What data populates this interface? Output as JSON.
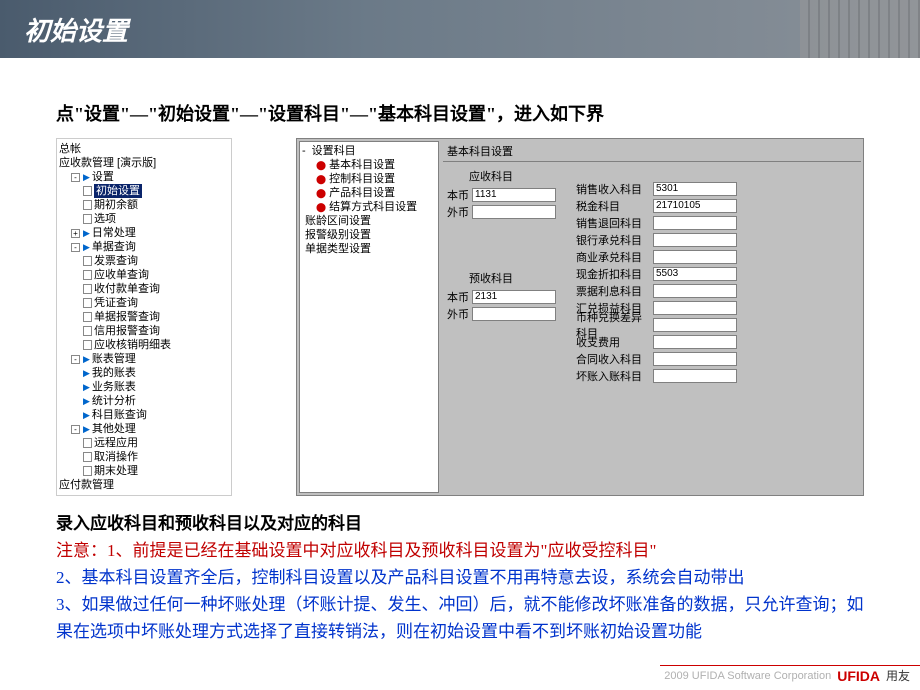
{
  "header": {
    "title": "初始设置"
  },
  "subtitle": "点\"设置\"—\"初始设置\"—\"设置科目\"—\"基本科目设置\"，进入如下界",
  "tree_left": {
    "root1": "总帐",
    "root2": "应收款管理 [演示版]",
    "n_settings": "设置",
    "n_init": "初始设置",
    "n_balance": "期初余额",
    "n_option": "选项",
    "n_daily": "日常处理",
    "n_bill": "单据查询",
    "n_invoice": "发票查询",
    "n_receipt": "应收单查询",
    "n_payment": "收付款单查询",
    "n_voucher": "凭证查询",
    "n_alarm": "单据报警查询",
    "n_credit": "信用报警查询",
    "n_verify": "应收核销明细表",
    "n_account": "账表管理",
    "n_myacc": "我的账表",
    "n_bizacc": "业务账表",
    "n_stat": "统计分析",
    "n_subacc": "科目账查询",
    "n_other": "其他处理",
    "n_remote": "远程应用",
    "n_cancel": "取消操作",
    "n_period": "期末处理",
    "root3": "应付款管理"
  },
  "tree_mid": {
    "root": "设置科目",
    "n1": "基本科目设置",
    "n2": "控制科目设置",
    "n3": "产品科目设置",
    "n4": "结算方式科目设置",
    "n5": "账龄区间设置",
    "n6": "报警级别设置",
    "n7": "单据类型设置"
  },
  "form": {
    "title": "基本科目设置",
    "sec_receivable": "应收科目",
    "sec_prepay": "预收科目",
    "lab_local": "本币",
    "lab_foreign": "外币",
    "val_1131": "1131",
    "val_2131": "2131",
    "r_sales": "销售收入科目",
    "r_tax": "税金科目",
    "r_return": "销售退回科目",
    "r_bank": "银行承兑科目",
    "r_commerce": "商业承兑科目",
    "r_cashdisc": "现金折扣科目",
    "r_billint": "票据利息科目",
    "r_exchange": "汇兑损益科目",
    "r_currdiff": "币种兑换差异科目",
    "r_fee": "收支费用",
    "r_contract": "合同收入科目",
    "r_baddebt": "坏账入账科目",
    "val_5301": "5301",
    "val_21710105": "21710105",
    "val_5503": "5503"
  },
  "body": {
    "p1": "录入应收科目和预收科目以及对应的科目",
    "p2a": "注意：1、前提是已经在基础设置中对应收科目及预收科目设置为\"应收受控科目\"",
    "p3": "2、基本科目设置齐全后，控制科目设置以及产品科目设置不用再特意去设，系统会自动带出",
    "p4": "3、如果做过任何一种坏账处理（坏账计提、发生、冲回）后，就不能修改坏账准备的数据，只允许查询；如果在选项中坏账处理方式选择了直接转销法，则在初始设置中看不到坏账初始设置功能"
  },
  "footer": {
    "copy": "2009 UFIDA Software Corporation",
    "logo": "UFIDA",
    "cn": "用友"
  }
}
